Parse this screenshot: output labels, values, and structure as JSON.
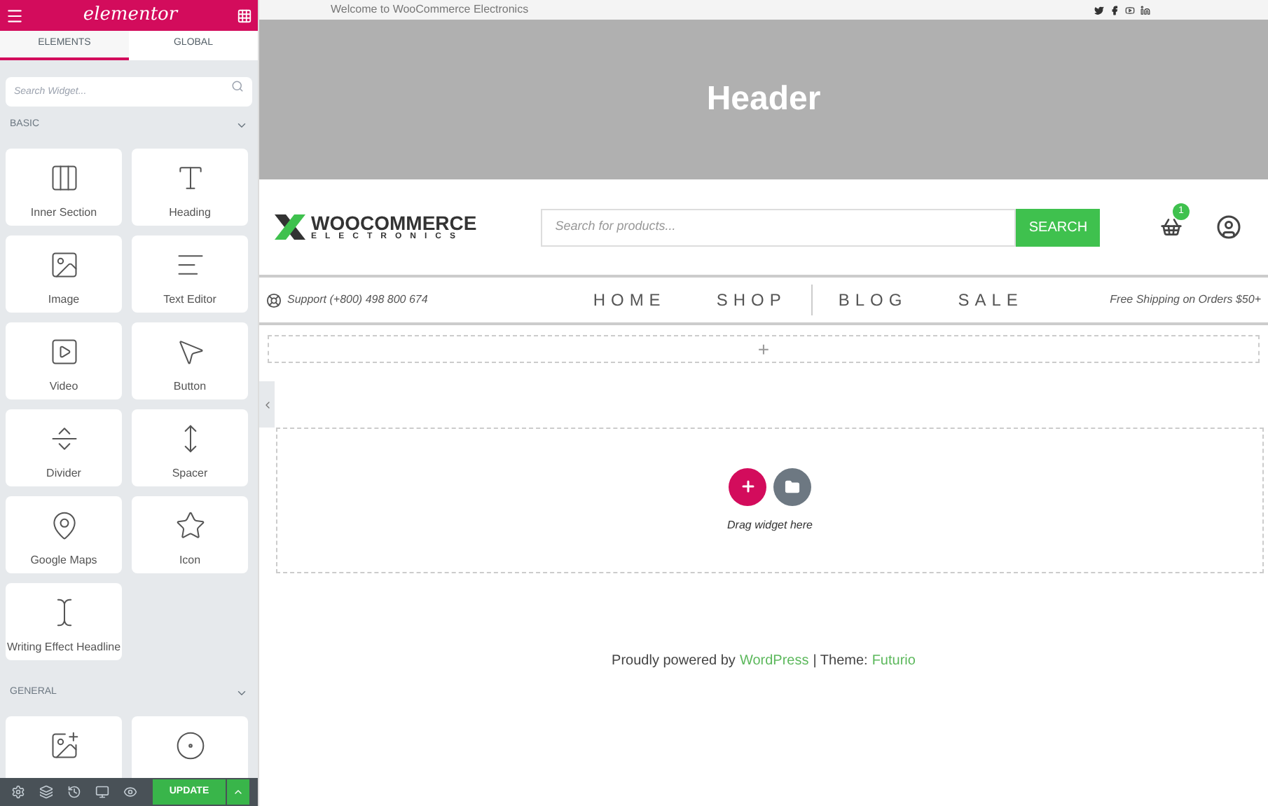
{
  "editor": {
    "logo": "elementor",
    "tabs": [
      {
        "label": "ELEMENTS",
        "selected": true
      },
      {
        "label": "GLOBAL",
        "selected": false
      }
    ],
    "search": {
      "placeholder": "Search Widget..."
    },
    "categories": [
      {
        "title": "BASIC",
        "expanded": true,
        "widgets": [
          {
            "label": "Inner Section",
            "kind": "columns"
          },
          {
            "label": "Heading",
            "kind": "heading"
          },
          {
            "label": "Image",
            "kind": "image"
          },
          {
            "label": "Text Editor",
            "kind": "text"
          },
          {
            "label": "Video",
            "kind": "video"
          },
          {
            "label": "Button",
            "kind": "button"
          },
          {
            "label": "Divider",
            "kind": "divider"
          },
          {
            "label": "Spacer",
            "kind": "spacer"
          },
          {
            "label": "Google Maps",
            "kind": "map"
          },
          {
            "label": "Icon",
            "kind": "star"
          },
          {
            "label": "Writing Effect Headline",
            "kind": "cursor"
          }
        ]
      },
      {
        "title": "GENERAL",
        "expanded": true,
        "widgets": [
          {
            "kind": "imagebox"
          },
          {
            "kind": "iconbox"
          }
        ]
      }
    ],
    "update_button": "UPDATE"
  },
  "site": {
    "welcome": "Welcome to WooCommerce Electronics",
    "header_title": "Header",
    "logo": {
      "main": "WOOCOMMERCE",
      "sub": "ELECTRONICS"
    },
    "search": {
      "placeholder": "Search for products...",
      "button": "SEARCH"
    },
    "cart_count": "1",
    "support": "Support (+800) 498 800 674",
    "nav": [
      "HOME",
      "SHOP",
      "BLOG",
      "SALE"
    ],
    "shipping": "Free Shipping on Orders $50+",
    "add_section": "+",
    "drop_hint": "Drag widget here",
    "footer": {
      "prefix": "Proudly powered by",
      "link1": "WordPress",
      "middle": "| Theme:",
      "link2": "Futurio"
    }
  }
}
